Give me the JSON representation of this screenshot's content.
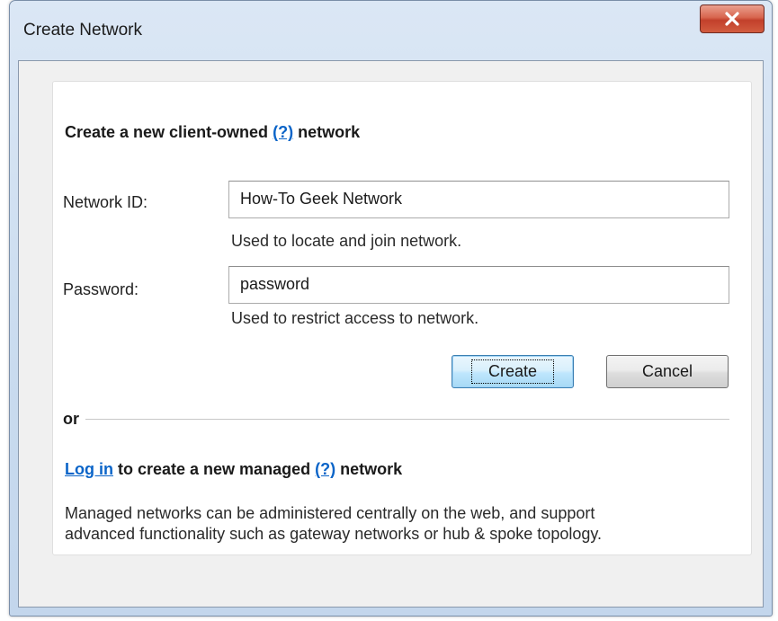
{
  "window": {
    "title": "Create Network",
    "close_icon": "close-x-icon"
  },
  "client_owned": {
    "heading_prefix": "Create a new client-owned",
    "help_link": "(?)",
    "heading_suffix": "network"
  },
  "form": {
    "network_id_label": "Network ID:",
    "network_id_value": "How-To Geek Network",
    "network_id_hint": "Used to locate and join network.",
    "password_label": "Password:",
    "password_value": "password",
    "password_hint": "Used to restrict access to network."
  },
  "buttons": {
    "create": "Create",
    "cancel": "Cancel"
  },
  "separator": {
    "or": "or"
  },
  "managed": {
    "login_link": "Log in",
    "heading_middle": "to create a new managed",
    "help_link": "(?)",
    "heading_suffix": "network",
    "description_line1": "Managed networks can be administered centrally on the web, and support",
    "description_line2": "advanced functionality such as gateway networks or hub & spoke topology."
  },
  "colors": {
    "link": "#0a64c8",
    "close_button": "#c2402b",
    "window_frame": "#c9dbef"
  }
}
